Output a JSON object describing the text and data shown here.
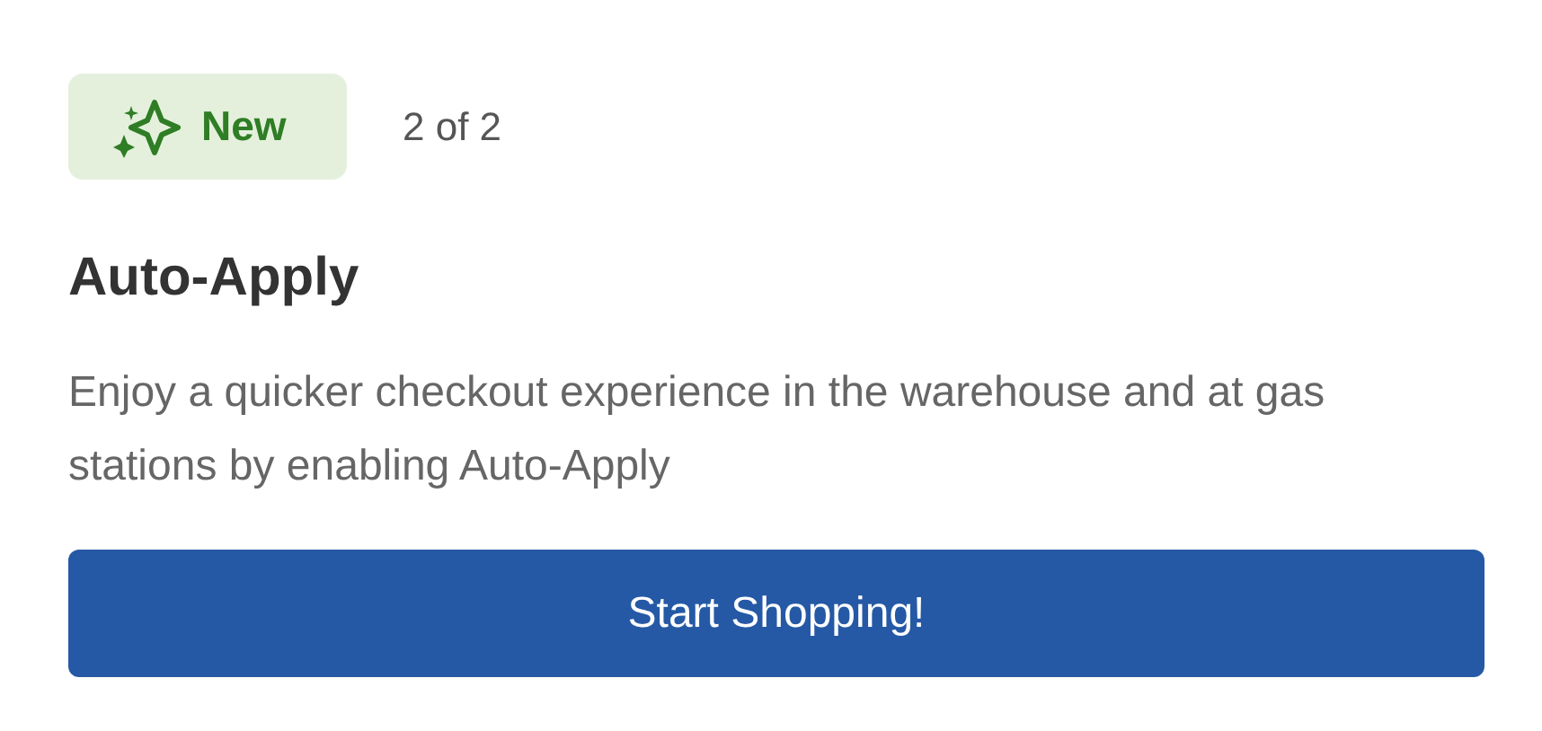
{
  "badge": {
    "label": "New"
  },
  "pager": "2 of 2",
  "title": "Auto-Apply",
  "description": "Enjoy a quicker checkout experience in the warehouse and at gas stations by enabling Auto-Apply",
  "button": {
    "label": "Start Shopping!"
  }
}
